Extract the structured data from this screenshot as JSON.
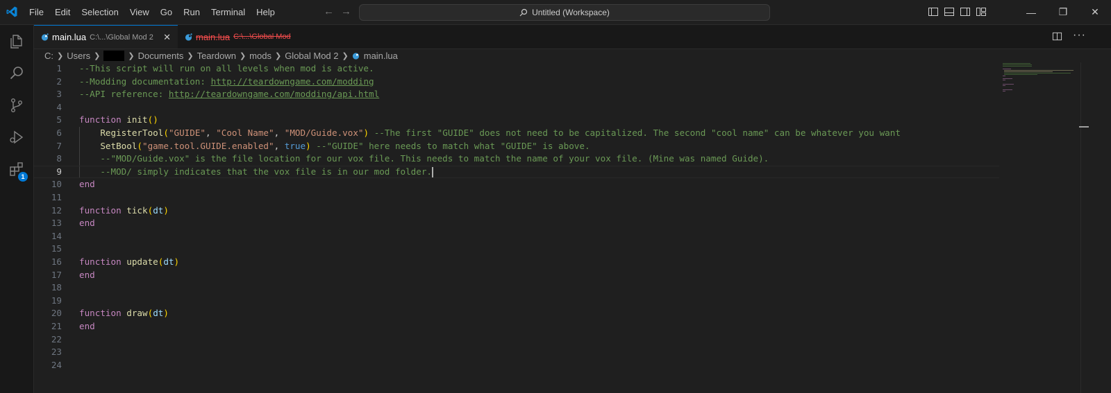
{
  "menu": [
    "File",
    "Edit",
    "Selection",
    "View",
    "Go",
    "Run",
    "Terminal",
    "Help"
  ],
  "command_center": {
    "label": "Untitled (Workspace)"
  },
  "tabs": [
    {
      "title": "main.lua",
      "description": "C:\\...\\Global Mod 2",
      "active": true,
      "close": "✕"
    },
    {
      "title": "main.lua",
      "description": "C:\\...\\Global Mod",
      "active": false,
      "deleted": true
    }
  ],
  "breadcrumb": [
    "C:",
    "Users",
    "Documents",
    "Teardown",
    "mods",
    "Global Mod 2",
    "main.lua"
  ],
  "activity_badge": "1",
  "editor": {
    "current_line": 9,
    "lines": [
      {
        "n": "1",
        "text": "--This script will run on all levels when mod is active."
      },
      {
        "n": "2",
        "text": "--Modding documentation: http://teardowngame.com/modding"
      },
      {
        "n": "3",
        "text": "--API reference: http://teardowngame.com/modding/api.html"
      },
      {
        "n": "4",
        "text": ""
      },
      {
        "n": "5",
        "text": "function init()"
      },
      {
        "n": "6",
        "text": "    RegisterTool(\"GUIDE\", \"Cool Name\", \"MOD/Guide.vox\") --The first \"GUIDE\" does not need to be capitalized. The second \"cool name\" can be whatever you want"
      },
      {
        "n": "7",
        "text": "    SetBool(\"game.tool.GUIDE.enabled\", true) --\"GUIDE\" here needs to match what \"GUIDE\" is above."
      },
      {
        "n": "8",
        "text": "    --\"MOD/Guide.vox\" is the file location for our vox file. This needs to match the name of your vox file. (Mine was named Guide)."
      },
      {
        "n": "9",
        "text": "    --MOD/ simply indicates that the vox file is in our mod folder."
      },
      {
        "n": "10",
        "text": "end"
      },
      {
        "n": "11",
        "text": ""
      },
      {
        "n": "12",
        "text": "function tick(dt)"
      },
      {
        "n": "13",
        "text": "end"
      },
      {
        "n": "14",
        "text": ""
      },
      {
        "n": "15",
        "text": ""
      },
      {
        "n": "16",
        "text": "function update(dt)"
      },
      {
        "n": "17",
        "text": "end"
      },
      {
        "n": "18",
        "text": ""
      },
      {
        "n": "19",
        "text": ""
      },
      {
        "n": "20",
        "text": "function draw(dt)"
      },
      {
        "n": "21",
        "text": "end"
      },
      {
        "n": "22",
        "text": ""
      },
      {
        "n": "23",
        "text": ""
      },
      {
        "n": "24",
        "text": ""
      }
    ]
  },
  "colors": {
    "accent": "#0078d4",
    "comment": "#6a9955",
    "keyword": "#c586c0",
    "function": "#dcdcaa",
    "string": "#ce9178",
    "bracket": "#ffd700",
    "parameter": "#9cdcfe",
    "boolean": "#569cd6",
    "deleted_tab": "#f14c4c"
  }
}
